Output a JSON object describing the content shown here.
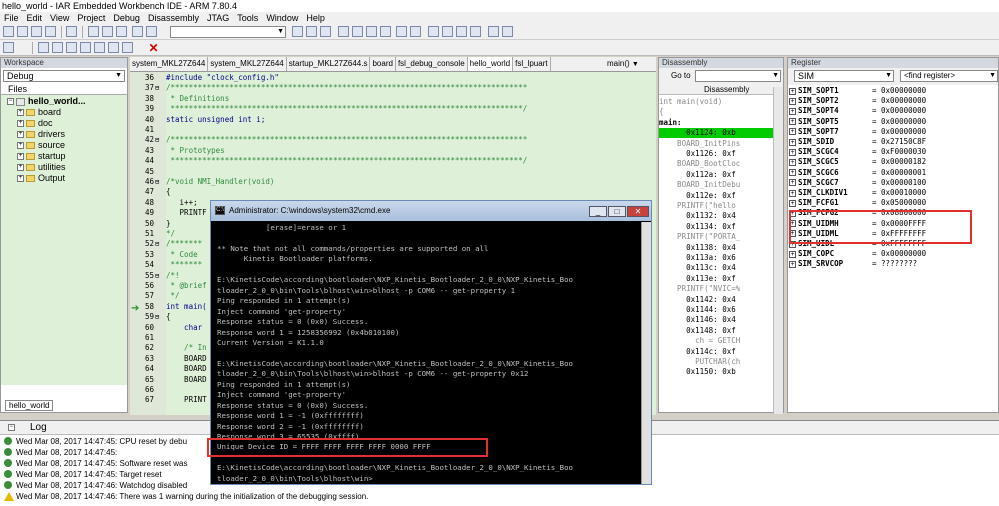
{
  "titlebar": {
    "title": "hello_world - IAR Embedded Workbench IDE - ARM 7.80.4"
  },
  "menu": [
    "File",
    "Edit",
    "View",
    "Project",
    "Debug",
    "Disassembly",
    "JTAG",
    "Tools",
    "Window",
    "Help"
  ],
  "workspace": {
    "header": "Workspace",
    "config": "Debug",
    "files_label": "Files",
    "tab": "hello_world",
    "tree": [
      {
        "label": "hello_world...",
        "kind": "project",
        "expanded": true
      },
      {
        "label": "board",
        "kind": "folder"
      },
      {
        "label": "doc",
        "kind": "folder"
      },
      {
        "label": "drivers",
        "kind": "folder"
      },
      {
        "label": "source",
        "kind": "folder"
      },
      {
        "label": "startup",
        "kind": "folder"
      },
      {
        "label": "utilities",
        "kind": "folder"
      },
      {
        "label": "Output",
        "kind": "folder"
      }
    ]
  },
  "editor": {
    "tabs": [
      "system_MKL27Z644",
      "system_MKL27Z644",
      "startup_MKL27Z644.s",
      "board",
      "fsl_debug_console",
      "hello_world",
      "fsl_lpuart"
    ],
    "active_tab": "hello_world",
    "func_combo": "main()",
    "lines": [
      {
        "n": "36",
        "t": "#include \"clock_config.h\""
      },
      {
        "n": "37",
        "t": "/*******************************************************************************"
      },
      {
        "n": "38",
        "t": " * Definitions"
      },
      {
        "n": "39",
        "t": " ******************************************************************************/"
      },
      {
        "n": "40",
        "t": "static unsigned int i;"
      },
      {
        "n": "41",
        "t": ""
      },
      {
        "n": "42",
        "t": "/*******************************************************************************"
      },
      {
        "n": "43",
        "t": " * Prototypes"
      },
      {
        "n": "44",
        "t": " ******************************************************************************/"
      },
      {
        "n": "45",
        "t": ""
      },
      {
        "n": "46",
        "t": "/*void NMI_Handler(void)"
      },
      {
        "n": "47",
        "t": "{"
      },
      {
        "n": "48",
        "t": "   i++;"
      },
      {
        "n": "49",
        "t": "   PRINTF"
      },
      {
        "n": "50",
        "t": "}"
      },
      {
        "n": "51",
        "t": "*/"
      },
      {
        "n": "52",
        "t": "/*******"
      },
      {
        "n": "53",
        "t": " * Code"
      },
      {
        "n": "54",
        "t": " *******"
      },
      {
        "n": "55",
        "t": "/*!"
      },
      {
        "n": "56",
        "t": " * @brief"
      },
      {
        "n": "57",
        "t": " */"
      },
      {
        "n": "58",
        "t": "int main("
      },
      {
        "n": "59",
        "t": "{"
      },
      {
        "n": "60",
        "t": "    char"
      },
      {
        "n": "61",
        "t": ""
      },
      {
        "n": "62",
        "t": "    /* In"
      },
      {
        "n": "63",
        "t": "    BOARD"
      },
      {
        "n": "64",
        "t": "    BOARD"
      },
      {
        "n": "65",
        "t": "    BOARD"
      },
      {
        "n": "66",
        "t": ""
      },
      {
        "n": "67",
        "t": "    PRINT"
      }
    ]
  },
  "disassembly": {
    "header": "Disassembly",
    "goto_label": "Go to",
    "line_header": "Disassembly",
    "lines": [
      {
        "t": "int main(void)",
        "kind": "src"
      },
      {
        "t": "{",
        "kind": "src"
      },
      {
        "t": "main:",
        "kind": "label"
      },
      {
        "t": "      0x1124: 0xb",
        "kind": "cur"
      },
      {
        "t": "    BOARD_InitPins",
        "kind": "src"
      },
      {
        "t": "      0x1126: 0xf",
        "kind": "asm"
      },
      {
        "t": "    BOARD_BootCloc",
        "kind": "src"
      },
      {
        "t": "      0x112a: 0xf",
        "kind": "asm"
      },
      {
        "t": "    BOARD_InitDebu",
        "kind": "src"
      },
      {
        "t": "      0x112e: 0xf",
        "kind": "asm"
      },
      {
        "t": "    PRINTF(\"hello",
        "kind": "src"
      },
      {
        "t": "      0x1132: 0x4",
        "kind": "asm"
      },
      {
        "t": "      0x1134: 0xf",
        "kind": "asm"
      },
      {
        "t": "    PRINTF(\"PORTA_",
        "kind": "src"
      },
      {
        "t": "      0x1138: 0x4",
        "kind": "asm"
      },
      {
        "t": "      0x113a: 0x6",
        "kind": "asm"
      },
      {
        "t": "      0x113c: 0x4",
        "kind": "asm"
      },
      {
        "t": "      0x113e: 0xf",
        "kind": "asm"
      },
      {
        "t": "    PRINTF(\"NVIC=%",
        "kind": "src"
      },
      {
        "t": "      0x1142: 0x4",
        "kind": "asm"
      },
      {
        "t": "      0x1144: 0x6",
        "kind": "asm"
      },
      {
        "t": "      0x1146: 0x4",
        "kind": "asm"
      },
      {
        "t": "      0x1148: 0xf",
        "kind": "asm"
      },
      {
        "t": "        ch = GETCH",
        "kind": "src"
      },
      {
        "t": "      0x114c: 0xf",
        "kind": "asm"
      },
      {
        "t": "        PUTCHAR(ch",
        "kind": "src"
      },
      {
        "t": "      0x1150: 0xb",
        "kind": "asm"
      }
    ]
  },
  "register": {
    "header": "Register",
    "group": "SIM",
    "find_placeholder": "<find register>",
    "rows": [
      {
        "name": "SIM_SOPT1",
        "val": "= 0x00000000"
      },
      {
        "name": "SIM_SOPT2",
        "val": "= 0x00000000"
      },
      {
        "name": "SIM_SOPT4",
        "val": "= 0x00000000"
      },
      {
        "name": "SIM_SOPT5",
        "val": "= 0x00000000"
      },
      {
        "name": "SIM_SOPT7",
        "val": "= 0x00000000"
      },
      {
        "name": "SIM_SDID",
        "val": "= 0x27150C8F"
      },
      {
        "name": "SIM_SCGC4",
        "val": "= 0xF0000030"
      },
      {
        "name": "SIM_SCGC5",
        "val": "= 0x00000182"
      },
      {
        "name": "SIM_SCGC6",
        "val": "= 0x00000001"
      },
      {
        "name": "SIM_SCGC7",
        "val": "= 0x00000100"
      },
      {
        "name": "SIM_CLKDIV1",
        "val": "= 0x00010000"
      },
      {
        "name": "SIM_FCFG1",
        "val": "= 0x05000000"
      },
      {
        "name": "SIM_FCFG2",
        "val": "= 0x08800000"
      },
      {
        "name": "SIM_UIDMH",
        "val": "= 0x0000FFFF"
      },
      {
        "name": "SIM_UIDML",
        "val": "= 0xFFFFFFFF"
      },
      {
        "name": "SIM_UIDL",
        "val": "= 0xFFFFFFFF"
      },
      {
        "name": "SIM_COPC",
        "val": "= 0x00000000"
      },
      {
        "name": "SIM_SRVCOP",
        "val": "= ????????"
      }
    ]
  },
  "cmd": {
    "title": "Administrator: C:\\windows\\system32\\cmd.exe",
    "lines": [
      "           [erase]=erase or 1",
      "",
      "** Note that not all commands/properties are supported on all",
      "      Kinetis Bootloader platforms.",
      "",
      "E:\\KinetisCode\\according\\bootloader\\NXP_Kinetis_Bootloader_2_0_0\\NXP_Kinetis_Boo",
      "tloader_2_0_0\\bin\\Tools\\blhost\\win>blhost -p COM6 -- get-property 1",
      "Ping responded in 1 attempt(s)",
      "Inject command 'get-property'",
      "Response status = 0 (0x0) Success.",
      "Response word 1 = 1258356992 (0x4b010100)",
      "Current Version = K1.1.0",
      "",
      "E:\\KinetisCode\\according\\bootloader\\NXP_Kinetis_Bootloader_2_0_0\\NXP_Kinetis_Boo",
      "tloader_2_0_0\\bin\\Tools\\blhost\\win>blhost -p COM6 -- get-property 0x12",
      "Ping responded in 1 attempt(s)",
      "Inject command 'get-property'",
      "Response status = 0 (0x0) Success.",
      "Response word 1 = -1 (0xffffffff)",
      "Response word 2 = -1 (0xffffffff)",
      "Response word 3 = 65535 (0xffff)",
      "Unique Device ID = FFFF FFFF FFFF FFFF 0000 FFFF",
      "",
      "E:\\KinetisCode\\according\\bootloader\\NXP_Kinetis_Bootloader_2_0_0\\NXP_Kinetis_Boo",
      "tloader_2_0_0\\bin\\Tools\\blhost\\win>"
    ]
  },
  "log": {
    "header": "Log",
    "rows": [
      {
        "icon": "info",
        "text": "Wed Mar 08, 2017 14:47:45: CPU reset by debu"
      },
      {
        "icon": "info",
        "text": "Wed Mar 08, 2017 14:47:45:"
      },
      {
        "icon": "info",
        "text": "Wed Mar 08, 2017 14:47:45: Software reset was"
      },
      {
        "icon": "info",
        "text": "Wed Mar 08, 2017 14:47:45: Target reset"
      },
      {
        "icon": "info",
        "text": "Wed Mar 08, 2017 14:47:46: Watchdog disabled"
      },
      {
        "icon": "warning",
        "text": "Wed Mar 08, 2017 14:47:46: There was 1 warning during the initialization of the debugging session."
      }
    ]
  }
}
